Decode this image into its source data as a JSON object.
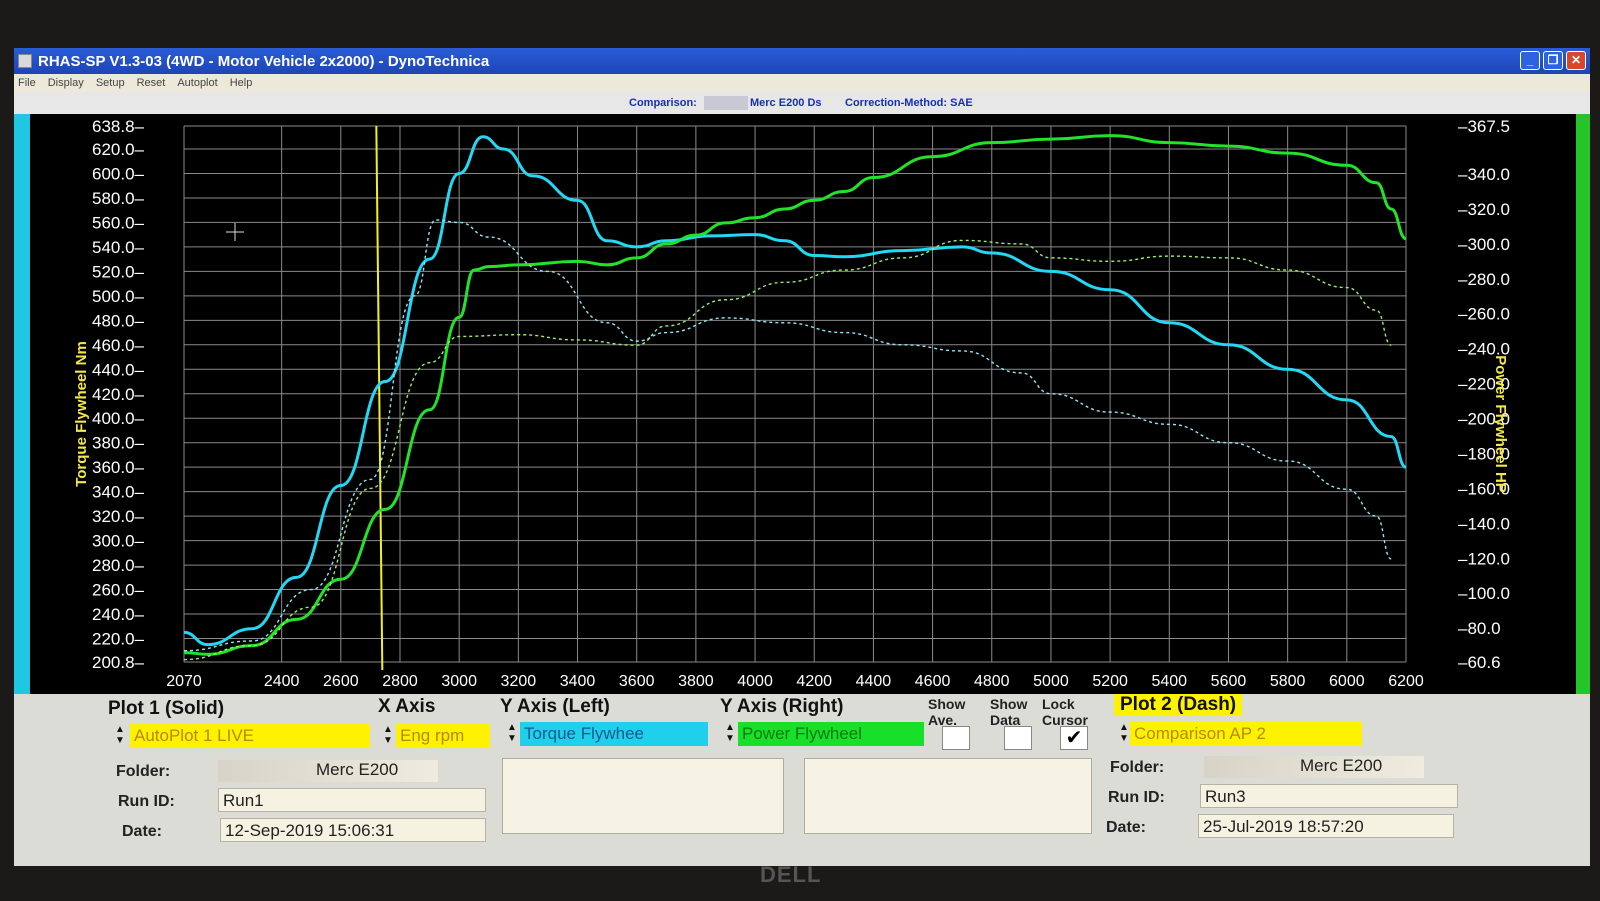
{
  "window": {
    "title": "RHAS-SP V1.3-03  (4WD - Motor Vehicle 2x2000) - DynoTechnica",
    "minimize_glyph": "_",
    "maximize_glyph": "❐",
    "close_glyph": "✕"
  },
  "menu": [
    "File",
    "Display",
    "Setup",
    "Reset",
    "Autoplot",
    "Help"
  ],
  "infobar": {
    "comparison_label": "Comparison:",
    "comparison_value": "Merc E200 Ds",
    "correction_label": "Correction-Method: SAE"
  },
  "chart_data": {
    "type": "line",
    "x_axis": {
      "label": "",
      "min": 2070,
      "max": 6200,
      "ticks": [
        2070,
        2400,
        2600,
        2800,
        3000,
        3200,
        3400,
        3600,
        3800,
        4000,
        4200,
        4400,
        4600,
        4800,
        5000,
        5200,
        5400,
        5600,
        5800,
        6000,
        6200
      ]
    },
    "y_left": {
      "label": "Torque Flywheel Nm",
      "min": 200.8,
      "max": 638.8,
      "ticks": [
        200.8,
        220.0,
        240.0,
        260.0,
        280.0,
        300.0,
        320.0,
        340.0,
        360.0,
        380.0,
        400.0,
        420.0,
        440.0,
        460.0,
        480.0,
        500.0,
        520.0,
        540.0,
        560.0,
        580.0,
        600.0,
        620.0,
        638.8
      ]
    },
    "y_right": {
      "label": "Power Flywheel HP",
      "min": 60.6,
      "max": 367.5,
      "ticks": [
        60.6,
        80.0,
        100.0,
        120.0,
        140.0,
        160.0,
        180.0,
        200.0,
        220.0,
        240.0,
        260.0,
        280.0,
        300.0,
        320.0,
        340.0,
        367.5
      ]
    },
    "cursor_x": 2720,
    "series": [
      {
        "name": "AutoPlot 1 LIVE - Torque Flywheel",
        "axis": "left",
        "style": "solid",
        "color": "#22d8f5",
        "x": [
          2070,
          2150,
          2300,
          2450,
          2600,
          2750,
          2900,
          3000,
          3080,
          3150,
          3250,
          3400,
          3500,
          3600,
          3700,
          3850,
          4000,
          4100,
          4200,
          4300,
          4500,
          4700,
          4800,
          5000,
          5200,
          5400,
          5600,
          5800,
          6000,
          6150,
          6200
        ],
        "y": [
          225,
          215,
          228,
          270,
          345,
          430,
          530,
          600,
          630,
          620,
          598,
          578,
          545,
          540,
          545,
          549,
          550,
          545,
          533,
          532,
          537,
          540,
          535,
          520,
          505,
          478,
          460,
          440,
          415,
          385,
          360
        ]
      },
      {
        "name": "AutoPlot 1 LIVE - Power Flywheel",
        "axis": "right",
        "style": "solid",
        "color": "#22e22a",
        "x": [
          2070,
          2150,
          2300,
          2450,
          2600,
          2750,
          2900,
          3000,
          3050,
          3100,
          3200,
          3400,
          3500,
          3600,
          3700,
          3800,
          3900,
          4000,
          4100,
          4200,
          4300,
          4400,
          4600,
          4800,
          5000,
          5200,
          5400,
          5600,
          5800,
          6000,
          6100,
          6150,
          6200
        ],
        "y": [
          66,
          65,
          70,
          85,
          108,
          148,
          205,
          258,
          285,
          287,
          288,
          290,
          288,
          292,
          300,
          305,
          312,
          315,
          320,
          325,
          330,
          338,
          350,
          358,
          360,
          362,
          358,
          356,
          352,
          345,
          335,
          320,
          303
        ]
      },
      {
        "name": "Comparison AP 2 - Torque Flywheel",
        "axis": "left",
        "style": "dashed",
        "color": "#8fe6f5",
        "x": [
          2070,
          2300,
          2500,
          2700,
          2850,
          2920,
          3000,
          3100,
          3300,
          3500,
          3600,
          3700,
          3900,
          4100,
          4300,
          4500,
          4700,
          4900,
          5000,
          5200,
          5400,
          5600,
          5800,
          6000,
          6100,
          6150
        ],
        "y": [
          210,
          218,
          260,
          350,
          500,
          562,
          560,
          548,
          520,
          478,
          463,
          470,
          482,
          478,
          470,
          460,
          455,
          437,
          420,
          405,
          395,
          380,
          365,
          342,
          320,
          285
        ]
      },
      {
        "name": "Comparison AP 2 - Power Flywheel",
        "axis": "right",
        "style": "dashed",
        "color": "#9aee66",
        "x": [
          2070,
          2300,
          2500,
          2700,
          2900,
          3000,
          3200,
          3400,
          3600,
          3700,
          3900,
          4100,
          4300,
          4500,
          4700,
          4900,
          5000,
          5200,
          5400,
          5600,
          5800,
          6000,
          6100,
          6150
        ],
        "y": [
          62,
          70,
          92,
          160,
          232,
          247,
          248,
          245,
          242,
          253,
          268,
          278,
          285,
          292,
          302,
          300,
          292,
          290,
          293,
          292,
          285,
          275,
          262,
          242
        ]
      }
    ]
  },
  "controls": {
    "plot1_label": "Plot 1 (Solid)",
    "x_axis_label": "X Axis",
    "y_left_label": "Y Axis (Left)",
    "y_right_label": "Y Axis (Right)",
    "show_ave_label": "Show Ave.",
    "show_data_label": "Show Data",
    "lock_cursor_label": "Lock Cursor",
    "plot2_label": "Plot 2 (Dash)",
    "plot1_value": "AutoPlot 1 LIVE",
    "x_axis_value": "Eng rpm",
    "y_left_value": "Torque Flywhee",
    "y_right_value": "Power Flywheel",
    "plot2_value": "Comparison AP 2",
    "show_ave_checked": false,
    "show_data_checked": false,
    "lock_cursor_checked": true,
    "checkmark": "✔"
  },
  "run1": {
    "folder_label": "Folder:",
    "folder_value": "Merc E200",
    "runid_label": "Run ID:",
    "runid_value": "Run1",
    "date_label": "Date:",
    "date_value": "12-Sep-2019  15:06:31"
  },
  "run2": {
    "folder_label": "Folder:",
    "folder_value": "Merc E200",
    "runid_label": "Run ID:",
    "runid_value": "Run3",
    "date_label": "Date:",
    "date_value": "25-Jul-2019  18:57:20"
  },
  "monitor_brand": "DELL"
}
